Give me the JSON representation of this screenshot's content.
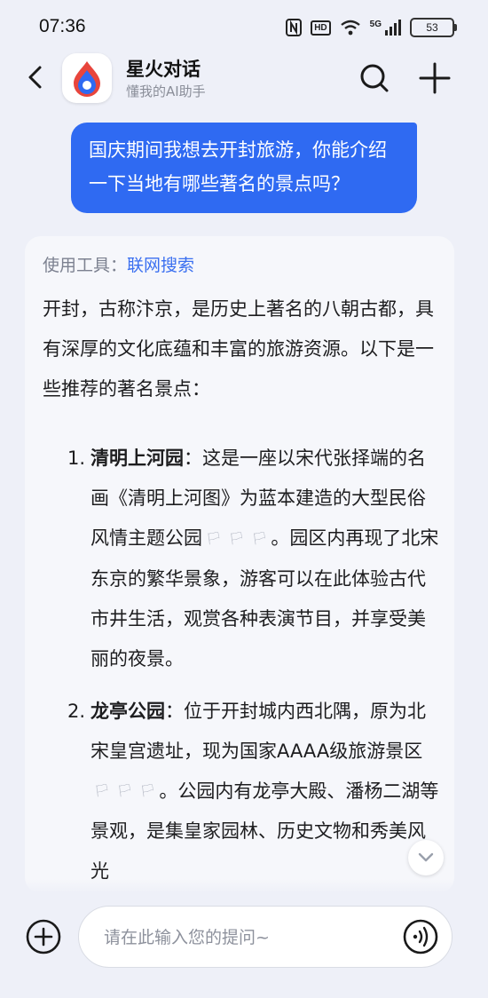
{
  "status_bar": {
    "time": "07:36",
    "hd_label": "HD",
    "network_label": "5G",
    "battery": "53"
  },
  "header": {
    "title": "星火对话",
    "subtitle": "懂我的AI助手"
  },
  "user_message": "国庆期间我想去开封旅游，你能介绍一下当地有哪些著名的景点吗？",
  "ai_message": {
    "tool_prefix": "使用工具：",
    "tool_name": "联网搜索",
    "intro": "开封，古称汴京，是历史上著名的八朝古都，具有深厚的文化底蕴和丰富的旅游资源。以下是一些推荐的著名景点：",
    "items": [
      {
        "number": "1.",
        "name": "清明上河园",
        "text_a": "：这是一座以宋代张择端的名画《清明上河图》为蓝本建造的大型民俗风情主题公园",
        "text_b": "。园区内再现了北宋东京的繁华景象，游客可以在此体验古代市井生活，观赏各种表演节目，并享受美丽的夜景。"
      },
      {
        "number": "2.",
        "name": "龙亭公园",
        "text_a": "：位于开封城内西北隅，原为北宋皇宫遗址，现为国家AAAA级旅游景区",
        "text_b": "。公园内有龙亭大殿、潘杨二湖等景观，是集皇家园林、历史文物和秀美风光"
      }
    ]
  },
  "input": {
    "placeholder": "请在此输入您的提问~"
  },
  "colors": {
    "accent": "#2f6af2",
    "link": "#3a6ff0",
    "background": "#eef0f8"
  },
  "icons": [
    "back-arrow-icon",
    "spark-logo-icon",
    "search-icon",
    "plus-icon",
    "citation-icon",
    "chevron-down-icon",
    "add-circle-icon",
    "voice-icon"
  ]
}
